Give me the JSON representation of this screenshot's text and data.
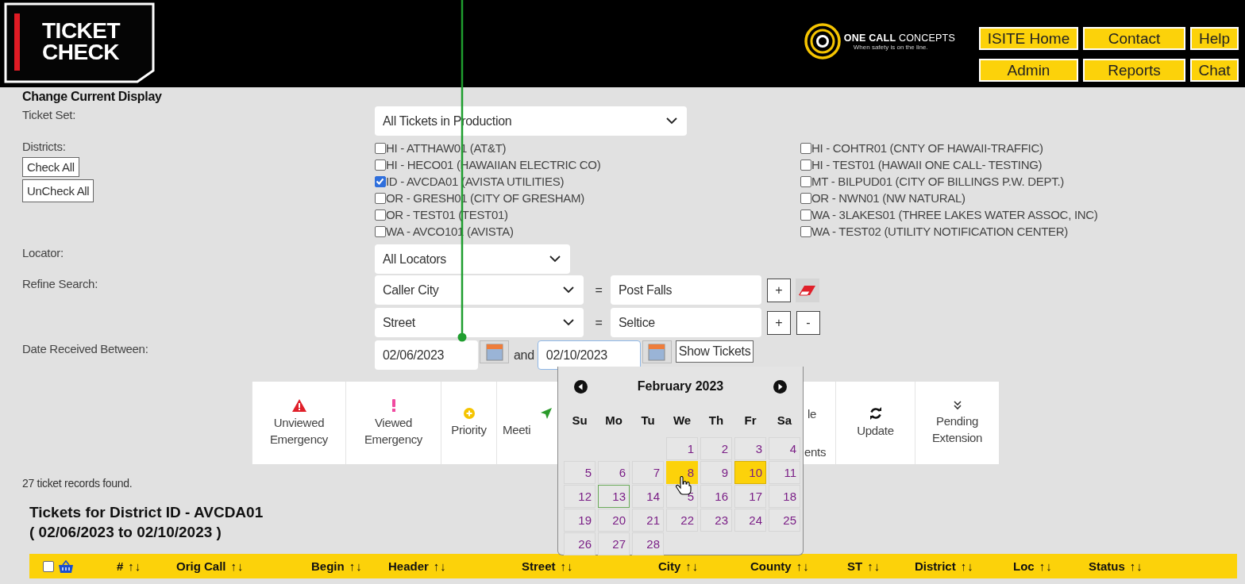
{
  "header": {
    "logo_lines": [
      "TICKET",
      "CHECK"
    ],
    "brand": "**ONE CALL** CONCEPTS",
    "tagline": "When safety is on the line.",
    "nav": [
      {
        "label": "ISITE Home"
      },
      {
        "label": "Contact"
      },
      {
        "label": "Help"
      },
      {
        "label": "Admin"
      },
      {
        "label": "Reports"
      },
      {
        "label": "Chat"
      }
    ]
  },
  "filters": {
    "title": "Change Current Display",
    "ticket_set": {
      "label": "Ticket Set:",
      "value": "All Tickets in Production"
    },
    "districts": {
      "label": "Districts:",
      "buttons": [
        "Check All",
        "UnCheck All"
      ],
      "options": [
        {
          "label": "HI - ATTHAW01 (AT&T)",
          "checked": false
        },
        {
          "label": "HI - HECO01 (HAWAIIAN ELECTRIC CO)",
          "checked": false
        },
        {
          "label": "ID - AVCDA01 (AVISTA UTILITIES)",
          "checked": true
        },
        {
          "label": "OR - GRESH01 (CITY OF GRESHAM)",
          "checked": false
        },
        {
          "label": "OR - TEST01 (TEST01)",
          "checked": false
        },
        {
          "label": "WA - AVCO101 (AVISTA)",
          "checked": false
        },
        {
          "label": "HI - COHTR01 (CNTY OF HAWAII-TRAFFIC)",
          "checked": false
        },
        {
          "label": "HI - TEST01 (HAWAII ONE CALL- TESTING)",
          "checked": false
        },
        {
          "label": "MT - BILPUD01 (CITY OF BILLINGS P.W. DEPT.)",
          "checked": false
        },
        {
          "label": "OR - NWN01 (NW NATURAL)",
          "checked": false
        },
        {
          "label": "WA - 3LAKES01 (THREE LAKES WATER ASSOC, INC)",
          "checked": false
        },
        {
          "label": "WA - TEST02 (UTILITY NOTIFICATION CENTER)",
          "checked": false
        }
      ]
    },
    "locator": {
      "label": "Locator:",
      "value": "All Locators"
    },
    "refine": {
      "label": "Refine Search:",
      "rows": [
        {
          "field": "Caller City",
          "operator": "=",
          "value": "Post Falls",
          "buttons": [
            {
              "kind": "add",
              "label": "+"
            },
            {
              "kind": "erase"
            }
          ]
        },
        {
          "field": "Street",
          "operator": "=",
          "value": "Seltice",
          "buttons": [
            {
              "kind": "add",
              "label": "+"
            },
            {
              "kind": "remove",
              "label": "-"
            }
          ]
        }
      ]
    },
    "date": {
      "label": "Date Received Between:",
      "from": "02/06/2023",
      "joiner": "and",
      "to": "02/10/2023",
      "button": "Show Tickets"
    }
  },
  "toolbar": {
    "items": [
      {
        "kind": "full",
        "label": "Unviewed Emergency"
      },
      {
        "kind": "full",
        "label": "Viewed Emergency"
      },
      {
        "kind": "full",
        "label": "Priority"
      },
      {
        "kind": "full",
        "label": "Meeti"
      },
      {
        "kind": "hidden"
      },
      {
        "kind": "partial",
        "label_top": "le",
        "label_bottom": "ents"
      },
      {
        "kind": "full",
        "label": "Update"
      },
      {
        "kind": "full",
        "label": "Pending Extension"
      }
    ]
  },
  "calendar": {
    "title": "February 2023",
    "weekdays": [
      "Su",
      "Mo",
      "Tu",
      "We",
      "Th",
      "Fr",
      "Sa"
    ],
    "weeks": [
      [
        {
          "kind": "empty"
        },
        {
          "kind": "empty"
        },
        {
          "kind": "empty"
        },
        {
          "day": "1",
          "selected": false,
          "hovered": false,
          "today": false
        },
        {
          "day": "2",
          "selected": false,
          "hovered": false,
          "today": false
        },
        {
          "day": "3",
          "selected": false,
          "hovered": false,
          "today": false
        },
        {
          "day": "4",
          "selected": false,
          "hovered": false,
          "today": false
        }
      ],
      [
        {
          "day": "5",
          "selected": false,
          "hovered": false,
          "today": false
        },
        {
          "day": "6",
          "selected": false,
          "hovered": false,
          "today": false
        },
        {
          "day": "7",
          "selected": false,
          "hovered": false,
          "today": false
        },
        {
          "day": "8",
          "selected": false,
          "hovered": true,
          "today": false
        },
        {
          "day": "9",
          "selected": false,
          "hovered": false,
          "today": false
        },
        {
          "day": "10",
          "selected": true,
          "hovered": false,
          "today": false
        },
        {
          "day": "11",
          "selected": false,
          "hovered": false,
          "today": false
        }
      ],
      [
        {
          "day": "12",
          "selected": false,
          "hovered": false,
          "today": false
        },
        {
          "day": "13",
          "selected": false,
          "hovered": false,
          "today": true
        },
        {
          "day": "14",
          "selected": false,
          "hovered": false,
          "today": false
        },
        {
          "day": "5",
          "selected": false,
          "hovered": false,
          "today": false
        },
        {
          "day": "16",
          "selected": false,
          "hovered": false,
          "today": false
        },
        {
          "day": "17",
          "selected": false,
          "hovered": false,
          "today": false
        },
        {
          "day": "18",
          "selected": false,
          "hovered": false,
          "today": false
        }
      ],
      [
        {
          "day": "19",
          "selected": false,
          "hovered": false,
          "today": false
        },
        {
          "day": "20",
          "selected": false,
          "hovered": false,
          "today": false
        },
        {
          "day": "21",
          "selected": false,
          "hovered": false,
          "today": false
        },
        {
          "day": "22",
          "selected": false,
          "hovered": false,
          "today": false
        },
        {
          "day": "23",
          "selected": false,
          "hovered": false,
          "today": false
        },
        {
          "day": "24",
          "selected": false,
          "hovered": false,
          "today": false
        },
        {
          "day": "25",
          "selected": false,
          "hovered": false,
          "today": false
        }
      ],
      [
        {
          "day": "26",
          "selected": false,
          "hovered": false,
          "today": false
        },
        {
          "day": "27",
          "selected": false,
          "hovered": false,
          "today": false
        },
        {
          "day": "28",
          "selected": false,
          "hovered": false,
          "today": false
        },
        {
          "kind": "empty"
        },
        {
          "kind": "empty"
        },
        {
          "kind": "empty"
        },
        {
          "kind": "empty"
        }
      ]
    ]
  },
  "results": {
    "count": "27 ticket records found.",
    "title_lines": [
      "Tickets for District ID - AVCDA01",
      "( 02/06/2023 to 02/10/2023 )"
    ],
    "table": {
      "select_all_checked": false,
      "columns": [
        {
          "label": "#",
          "sort": "↑↓"
        },
        {
          "label": "Orig Call",
          "sort": "↑↓"
        },
        {
          "label": "Begin",
          "sort": "↑↓"
        },
        {
          "label": "Header",
          "sort": "↑↓"
        },
        {
          "label": "Street",
          "sort": "↑↓"
        },
        {
          "label": "City",
          "sort": "↑↓"
        },
        {
          "label": "County",
          "sort": "↑↓"
        },
        {
          "label": "ST",
          "sort": "↑↓"
        },
        {
          "label": "District",
          "sort": "↑↓"
        },
        {
          "label": "Loc",
          "sort": "↑↓"
        },
        {
          "label": "Status",
          "sort": "↑↓"
        }
      ]
    }
  }
}
